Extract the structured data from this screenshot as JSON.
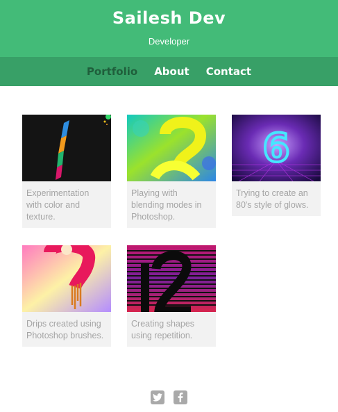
{
  "site": {
    "name": "Sailesh Dev",
    "tagline": "Developer"
  },
  "nav": {
    "items": [
      {
        "label": "Portfolio",
        "active": true
      },
      {
        "label": "About",
        "active": false
      },
      {
        "label": "Contact",
        "active": false
      }
    ]
  },
  "portfolio": {
    "items": [
      {
        "caption": "Experimentation with color and texture.",
        "image": "color-stripe-numeral-one"
      },
      {
        "caption": "Playing with blending modes in Photoshop.",
        "image": "gradient-blend-numeral"
      },
      {
        "caption": "Trying to create an 80's style of glows.",
        "image": "neon-glow-six"
      },
      {
        "caption": "Drips created using Photoshop brushes.",
        "image": "dripping-numeral"
      },
      {
        "caption": "Creating shapes using repetition.",
        "image": "striped-twelve"
      }
    ]
  },
  "footer": {
    "icons": [
      "twitter-icon",
      "facebook-icon"
    ]
  }
}
